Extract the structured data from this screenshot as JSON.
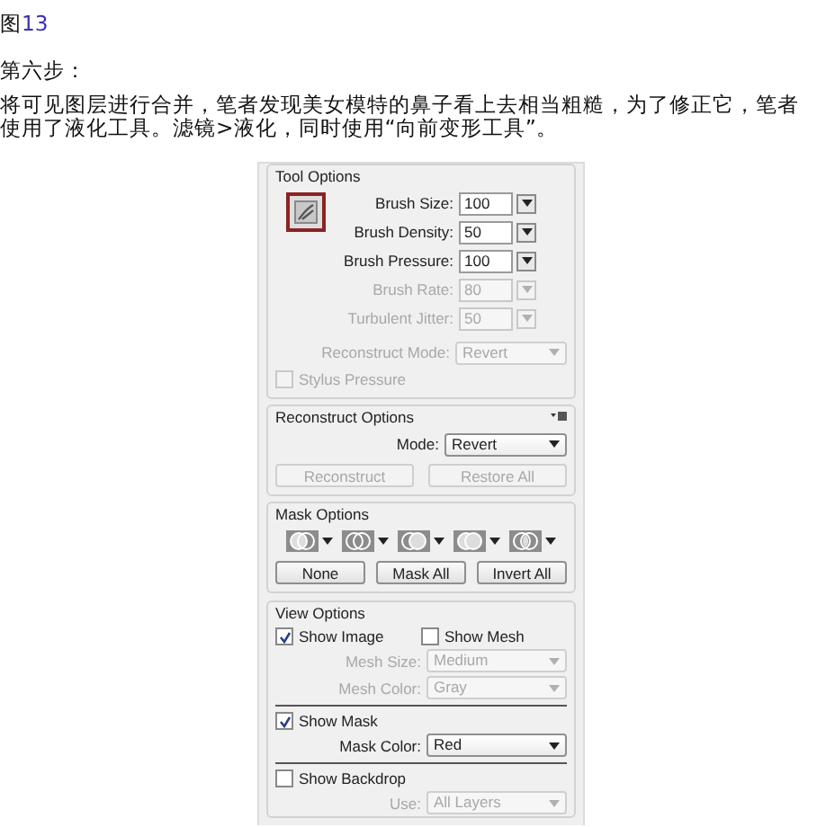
{
  "caption": {
    "prefix": "图",
    "number": "13"
  },
  "step": "第六步：",
  "paragraph": "将可见图层进行合并，笔者发现美女模特的鼻子看上去相当粗糙，为了修正它，笔者使用了液化工具。滤镜>液化，同时使用“向前变形工具”。",
  "panel": {
    "tool_options": {
      "title": "Tool Options",
      "fields": [
        {
          "label": "Brush Size:",
          "value": "100",
          "disabled": false,
          "kind": "combo"
        },
        {
          "label": "Brush Density:",
          "value": "50",
          "disabled": false,
          "kind": "combo"
        },
        {
          "label": "Brush Pressure:",
          "value": "100",
          "disabled": false,
          "kind": "combo"
        },
        {
          "label": "Brush Rate:",
          "value": "80",
          "disabled": true,
          "kind": "combo"
        },
        {
          "label": "Turbulent Jitter:",
          "value": "50",
          "disabled": true,
          "kind": "combo"
        },
        {
          "label": "Reconstruct Mode:",
          "value": "Revert",
          "disabled": true,
          "kind": "select"
        }
      ],
      "stylus_pressure": {
        "label": "Stylus Pressure",
        "checked": false,
        "disabled": true
      }
    },
    "reconstruct_options": {
      "title": "Reconstruct Options",
      "mode": {
        "label": "Mode:",
        "value": "Revert",
        "disabled": false
      },
      "buttons": [
        {
          "label": "Reconstruct",
          "disabled": true
        },
        {
          "label": "Restore All",
          "disabled": true
        }
      ]
    },
    "mask_options": {
      "title": "Mask Options",
      "buttons": [
        {
          "label": "None",
          "disabled": false
        },
        {
          "label": "Mask All",
          "disabled": false
        },
        {
          "label": "Invert All",
          "disabled": false
        }
      ]
    },
    "view_options": {
      "title": "View Options",
      "groups": [
        [
          {
            "kind": "checkboxes",
            "boxes": [
              {
                "label": "Show Image",
                "checked": true,
                "disabled": false
              },
              {
                "label": "Show Mesh",
                "checked": false,
                "disabled": false
              }
            ]
          },
          {
            "kind": "select",
            "label": "Mesh Size:",
            "value": "Medium",
            "disabled": true
          },
          {
            "kind": "select",
            "label": "Mesh Color:",
            "value": "Gray",
            "disabled": true
          }
        ],
        [
          {
            "kind": "checkboxes",
            "boxes": [
              {
                "label": "Show Mask",
                "checked": true,
                "disabled": false
              }
            ]
          },
          {
            "kind": "select",
            "label": "Mask Color:",
            "value": "Red",
            "disabled": false
          }
        ],
        [
          {
            "kind": "checkboxes",
            "boxes": [
              {
                "label": "Show Backdrop",
                "checked": false,
                "disabled": false
              }
            ]
          },
          {
            "kind": "select",
            "label": "Use:",
            "value": "All Layers",
            "disabled": true
          }
        ]
      ]
    }
  }
}
